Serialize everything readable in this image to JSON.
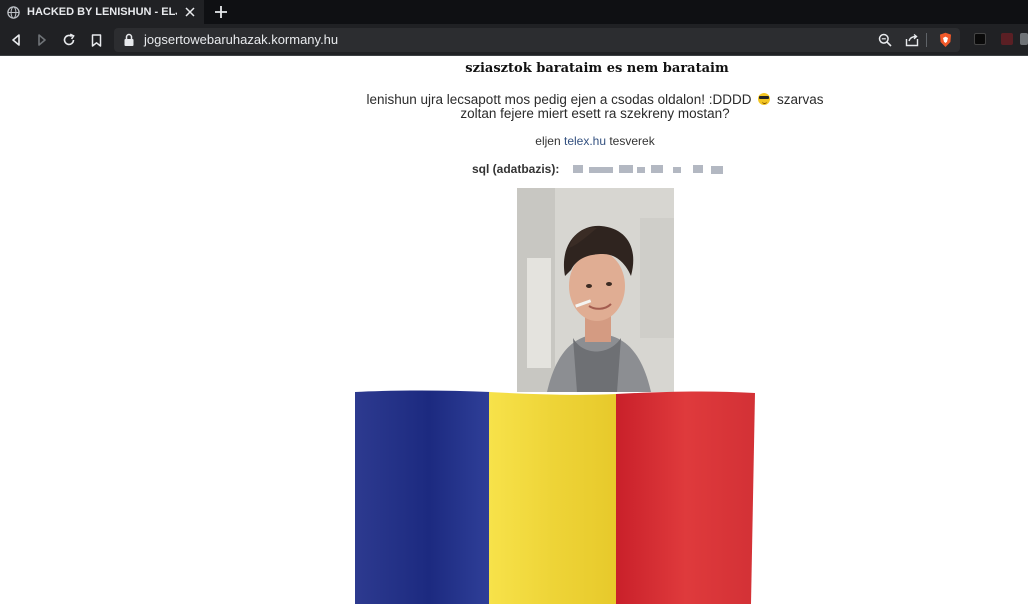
{
  "browser": {
    "tab_title": "HACKED BY LENISHUN - ELJEN Z",
    "url": "jogsertowebaruhazak.kormany.hu",
    "accent": "#202124"
  },
  "content": {
    "heading": "sziasztok barataim es nem barataim",
    "message_part1": "lenishun ujra lecsapott mos pedig ejen a csodas oldalon! :DDDD",
    "message_emoji": "sunglasses-emoji",
    "message_part2": "szarvas zoltan fejere miert esett ra szekreny mostan?",
    "shout_prefix": "eljen ",
    "shout_link": "telex.hu",
    "shout_suffix": " tesverek",
    "sql_label": "sql (adatbazis):",
    "sql_value_state": "pixelated"
  },
  "flag": {
    "colors": [
      "#25348f",
      "#f3dc3a",
      "#d72b2c"
    ]
  }
}
